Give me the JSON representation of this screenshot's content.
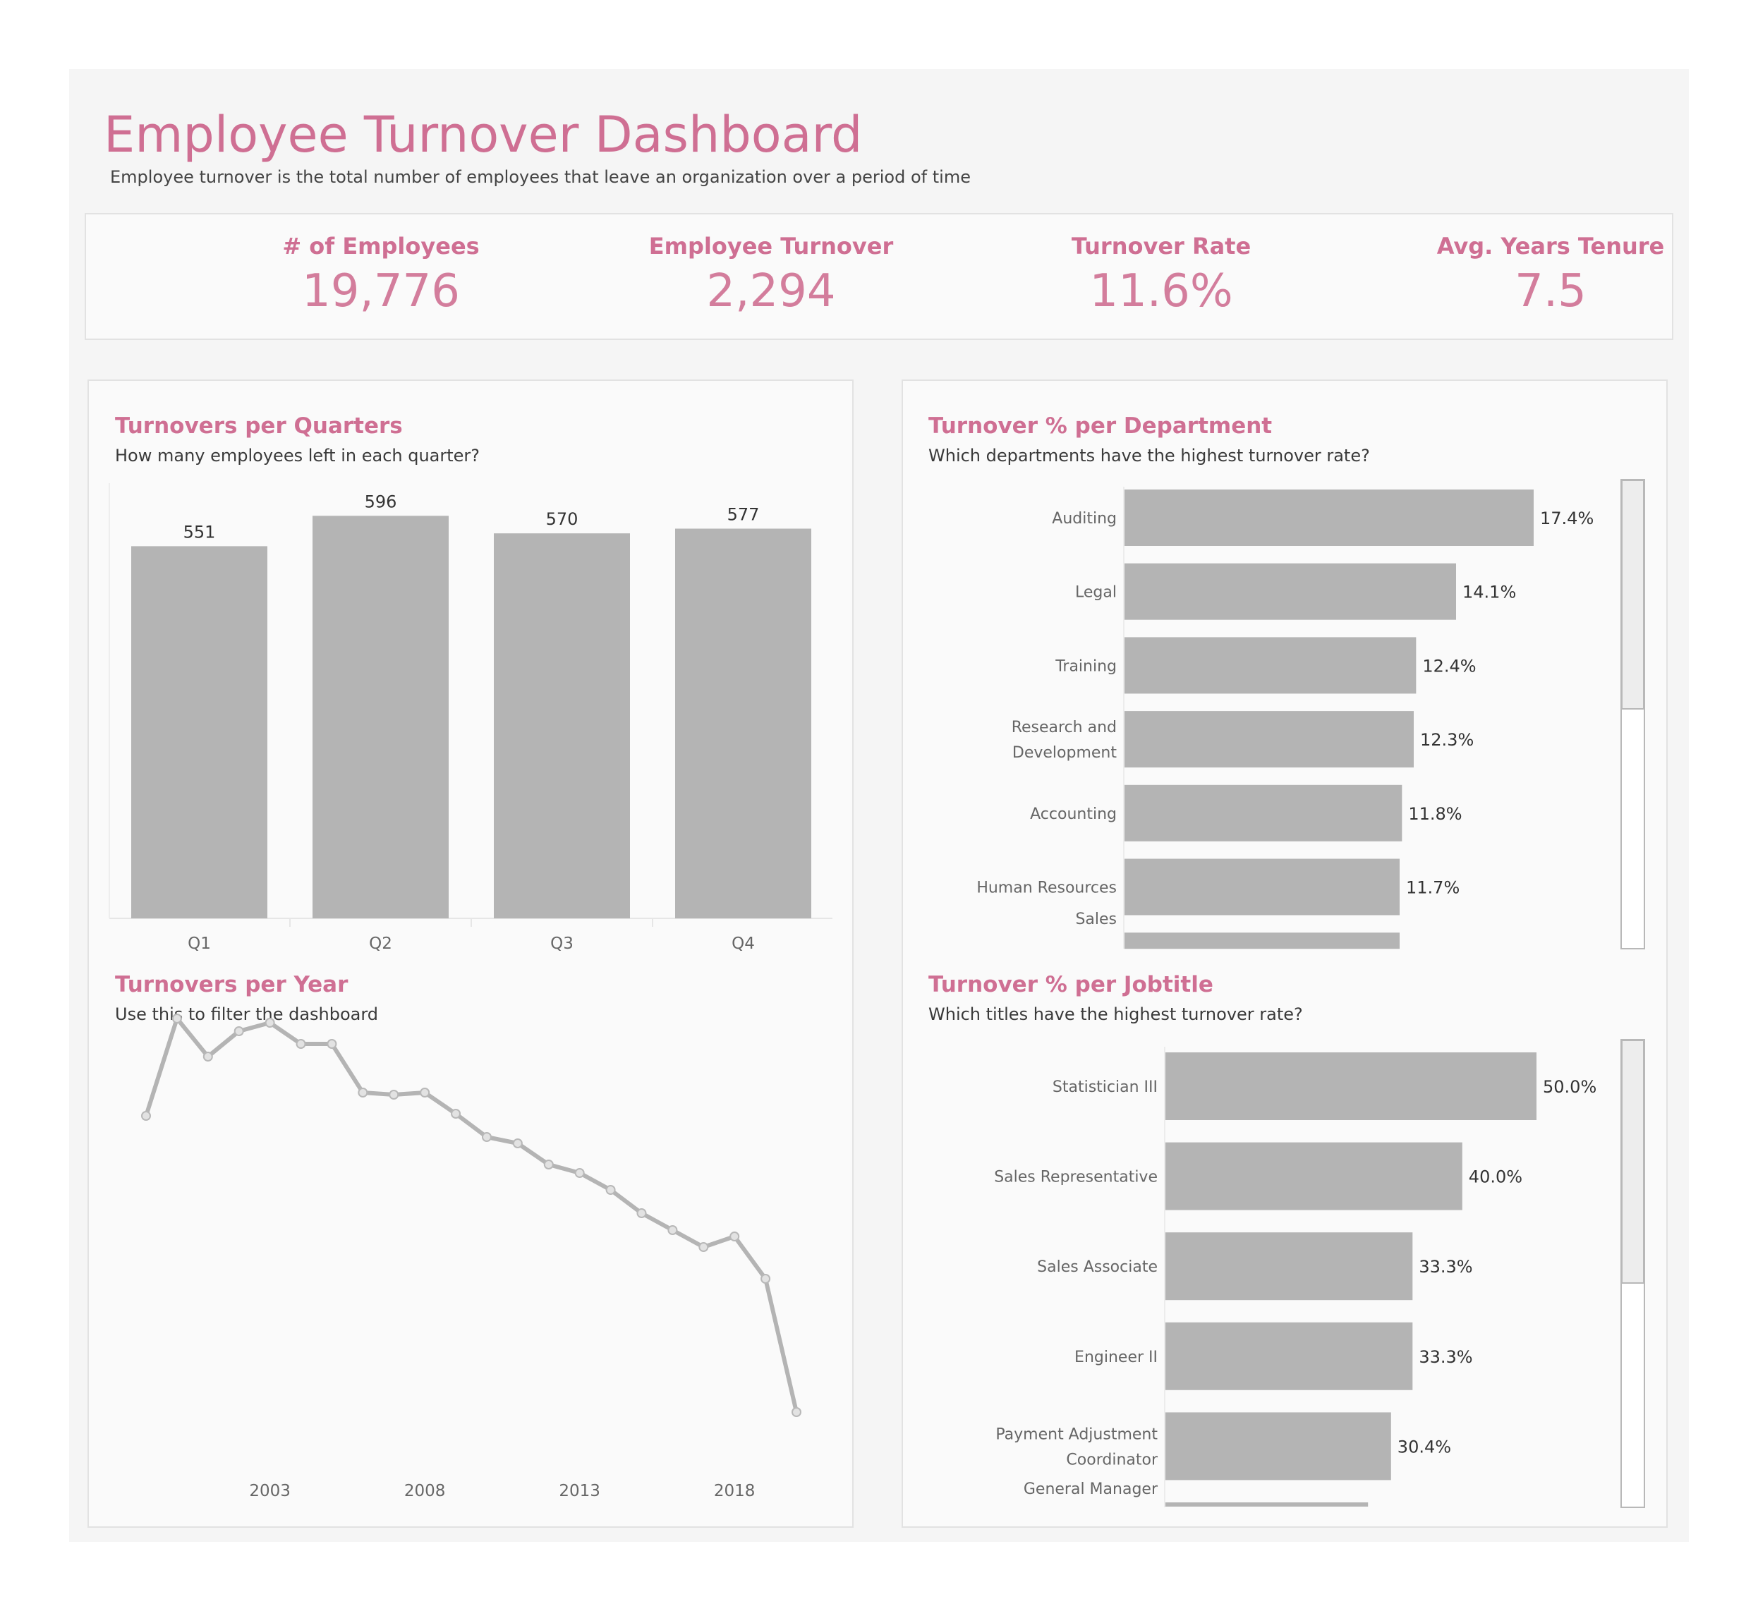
{
  "header": {
    "title": "Employee Turnover Dashboard",
    "subtitle": "Employee turnover is the total number of employees that leave an organization over a period of time"
  },
  "kpis": [
    {
      "label": "# of Employees",
      "value": "19,776"
    },
    {
      "label": "Employee Turnover",
      "value": "2,294"
    },
    {
      "label": "Turnover Rate",
      "value": "11.6%"
    },
    {
      "label": "Avg. Years Tenure",
      "value": "7.5"
    }
  ],
  "panels": {
    "quarters": {
      "title": "Turnovers per Quarters",
      "subtitle": "How many employees left in each quarter?"
    },
    "years": {
      "title": "Turnovers per Year",
      "subtitle": "Use this to filter the dashboard"
    },
    "departments": {
      "title": "Turnover % per Department",
      "subtitle": "Which departments have the highest turnover rate?"
    },
    "jobtitles": {
      "title": "Turnover % per Jobtitle",
      "subtitle": "Which titles have the highest turnover rate?"
    }
  },
  "colors": {
    "accent": "#cf6f93",
    "bar": "#b4b4b4",
    "line": "#b4b4b4",
    "panel_bg": "#fafafa",
    "page_bg": "#f5f5f5"
  },
  "chart_data": [
    {
      "id": "quarters",
      "type": "bar",
      "categories": [
        "Q1",
        "Q2",
        "Q3",
        "Q4"
      ],
      "values": [
        551,
        596,
        570,
        577
      ],
      "data_labels": [
        "551",
        "596",
        "570",
        "577"
      ],
      "ylim": [
        0,
        660
      ]
    },
    {
      "id": "years",
      "type": "line",
      "x": [
        1999,
        2000,
        2001,
        2002,
        2003,
        2004,
        2005,
        2006,
        2007,
        2008,
        2009,
        2010,
        2011,
        2012,
        2013,
        2014,
        2015,
        2016,
        2017,
        2018,
        2019,
        2020
      ],
      "values": [
        140,
        186,
        168,
        180,
        184,
        174,
        174,
        151,
        150,
        151,
        141,
        130,
        127,
        117,
        113,
        105,
        94,
        86,
        78,
        83,
        63,
        0
      ],
      "xticks": [
        "2003",
        "2008",
        "2013",
        "2018"
      ],
      "ylim": [
        0,
        200
      ]
    },
    {
      "id": "departments",
      "type": "bar",
      "orientation": "horizontal",
      "categories": [
        "Auditing",
        "Legal",
        "Training",
        "Research and Development",
        "Accounting",
        "Human Resources",
        "Sales"
      ],
      "values": [
        17.4,
        14.1,
        12.4,
        12.3,
        11.8,
        11.7,
        11.7
      ],
      "data_labels": [
        "17.4%",
        "14.1%",
        "12.4%",
        "12.3%",
        "11.8%",
        "11.7%",
        ""
      ],
      "xlim": [
        0,
        20
      ]
    },
    {
      "id": "jobtitles",
      "type": "bar",
      "orientation": "horizontal",
      "categories": [
        "Statistician III",
        "Sales Representative",
        "Sales Associate",
        "Engineer II",
        "Payment Adjustment Coordinator",
        "General Manager"
      ],
      "values": [
        50.0,
        40.0,
        33.3,
        33.3,
        30.4,
        27.3
      ],
      "data_labels": [
        "50.0%",
        "40.0%",
        "33.3%",
        "33.3%",
        "30.4%",
        ""
      ],
      "xlim": [
        0,
        60
      ]
    }
  ]
}
